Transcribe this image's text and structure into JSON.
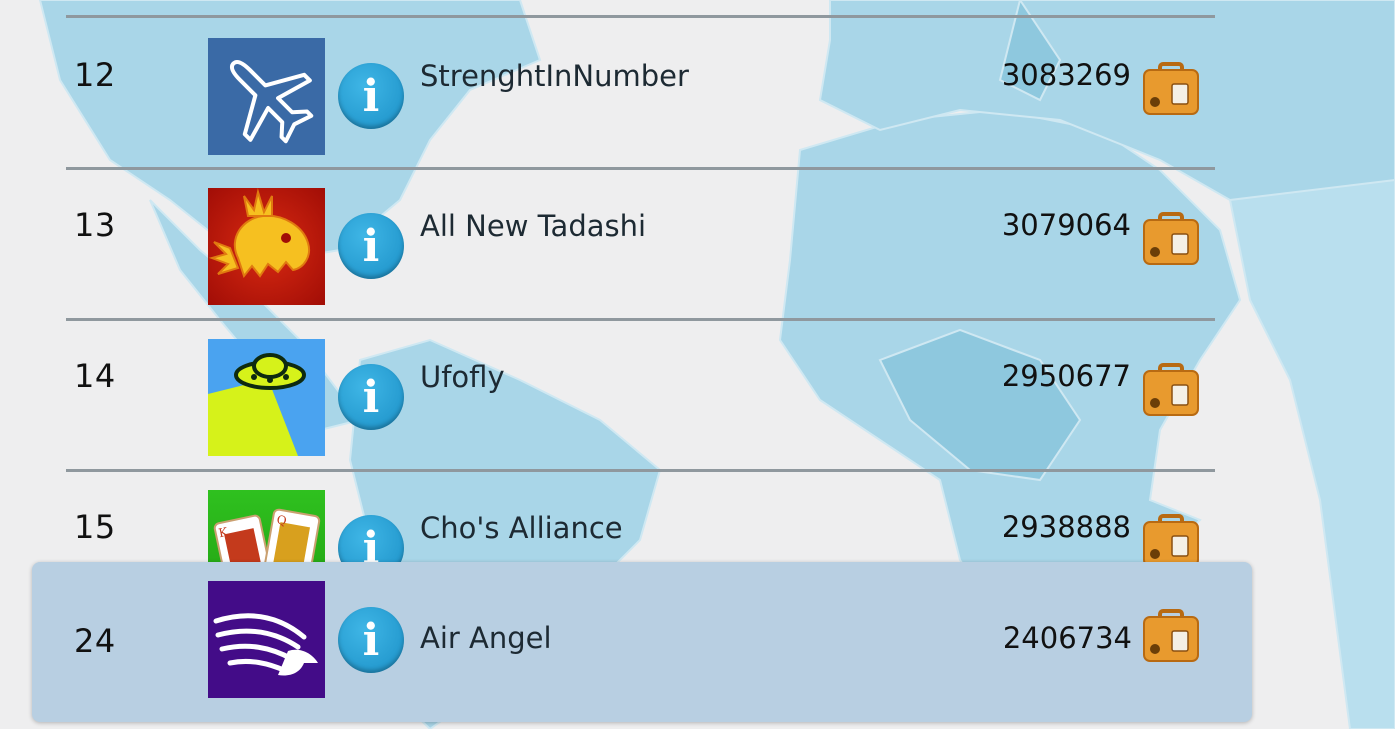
{
  "leaderboard": {
    "rows": [
      {
        "rank": "12",
        "name": "StrenghtInNumber",
        "score": "3083269",
        "logo_icon": "airplane-logo"
      },
      {
        "rank": "13",
        "name": "All New Tadashi",
        "score": "3079064",
        "logo_icon": "dragon-logo"
      },
      {
        "rank": "14",
        "name": "Ufofly",
        "score": "2950677",
        "logo_icon": "ufo-logo"
      },
      {
        "rank": "15",
        "name": "Cho's Alliance",
        "score": "2938888",
        "logo_icon": "playing-cards-logo"
      }
    ],
    "current_player": {
      "rank": "24",
      "name": "Air Angel",
      "score": "2406734",
      "logo_icon": "winged-eagle-logo"
    }
  },
  "info_glyph": "i",
  "colors": {
    "info_blue": "#2aa3d8",
    "highlight": "#b8cfe2",
    "suitcase": "#e89a2e",
    "map_land": "#a9d6e8"
  }
}
